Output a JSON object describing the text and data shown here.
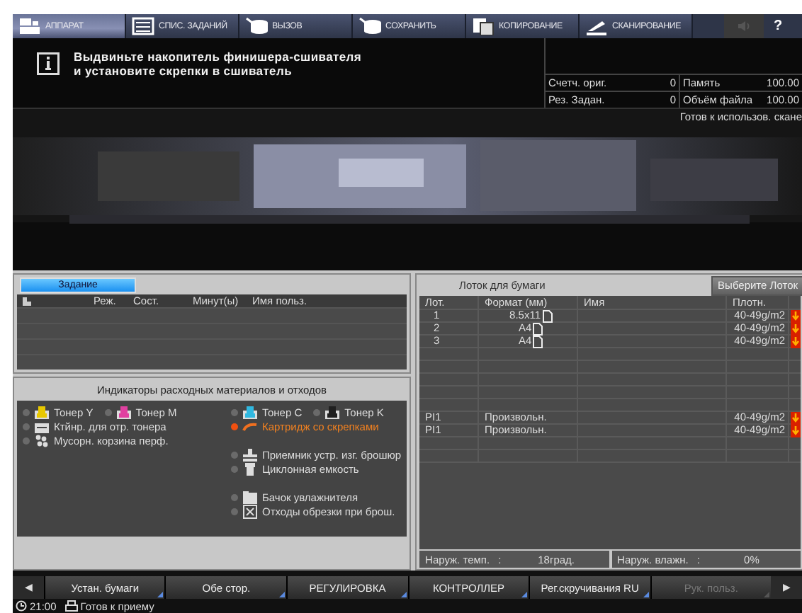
{
  "tabs": [
    {
      "label": "АППАРАТ",
      "kind": "machine",
      "selected": true
    },
    {
      "label": "СПИС. ЗАДАНИЙ",
      "kind": "list",
      "selected": false
    },
    {
      "label": "ВЫЗОВ",
      "kind": "recall",
      "selected": false
    },
    {
      "label": "СОХРАНИТЬ",
      "kind": "save",
      "selected": false
    },
    {
      "label": "КОПИРОВАНИЕ",
      "kind": "copy",
      "selected": false
    },
    {
      "label": "СКАНИРОВАНИЕ",
      "kind": "scan",
      "selected": false
    }
  ],
  "help": "?",
  "message": [
    "Выдвиньте накопитель финишера-сшивателя",
    "и установите скрепки в сшиватель"
  ],
  "counters": [
    {
      "label": "Счетч. ориг.",
      "value": "0"
    },
    {
      "label": "Память",
      "value": "100.00"
    },
    {
      "label": "Рез. Задан.",
      "value": "0"
    },
    {
      "label": "Объём файла",
      "value": "100.00"
    }
  ],
  "machine_status": "Готов к использов. скане",
  "jobs": {
    "tab": "Задание",
    "columns": [
      "Реж.",
      "Сост.",
      "Минут(ы)",
      "Имя польз."
    ]
  },
  "consumables": {
    "title": "Индикаторы расходных материалов и отходов",
    "columns": [
      {
        "groups": [
          {
            "rows": [
              {
                "items": [
                  {
                    "label": "Тонер Y",
                    "kind": "toner",
                    "color": "#e8c800",
                    "alert": false
                  },
                  {
                    "label": "Тонер M",
                    "kind": "toner",
                    "color": "#e040a0",
                    "alert": false
                  }
                ]
              },
              {
                "items": [
                  {
                    "label": "Ктйнр. для отр. тонера",
                    "kind": "waste",
                    "alert": false
                  }
                ]
              },
              {
                "items": [
                  {
                    "label": "Мусорн. корзина перф.",
                    "kind": "punch",
                    "alert": false
                  }
                ]
              }
            ]
          }
        ]
      },
      {
        "groups": [
          {
            "rows": [
              {
                "items": [
                  {
                    "label": "Тонер C",
                    "kind": "toner",
                    "color": "#30b8e0",
                    "alert": false
                  },
                  {
                    "label": "Тонер K",
                    "kind": "toner",
                    "color": "#202020",
                    "alert": false
                  }
                ]
              },
              {
                "items": [
                  {
                    "label": "Картридж со скрепками",
                    "kind": "staple",
                    "alert": true
                  }
                ]
              }
            ]
          },
          {
            "rows": [
              {
                "items": [
                  {
                    "label": "Приемник устр. изг. брошюр",
                    "kind": "tray",
                    "alert": false
                  }
                ]
              },
              {
                "items": [
                  {
                    "label": "Циклонная емкость",
                    "kind": "cyclone",
                    "alert": false
                  }
                ]
              }
            ]
          },
          {
            "rows": [
              {
                "items": [
                  {
                    "label": "Бачок увлажнителя",
                    "kind": "tank",
                    "alert": false
                  }
                ]
              },
              {
                "items": [
                  {
                    "label": "Отходы обрезки при брош.",
                    "kind": "trim",
                    "alert": false
                  }
                ]
              }
            ]
          }
        ]
      }
    ]
  },
  "trays": {
    "title": "Лоток для бумаги",
    "button": "Выберите Лоток",
    "columns": [
      "Лот.",
      "Формат (мм)",
      "Имя",
      "Плотн."
    ],
    "rows": [
      {
        "lot": "1",
        "format": "8.5x11",
        "portrait": true,
        "weight": "40-49g/m2",
        "empty": true
      },
      {
        "lot": "2",
        "format": "A4",
        "portrait": true,
        "weight": "40-49g/m2",
        "empty": true
      },
      {
        "lot": "3",
        "format": "A4",
        "portrait": true,
        "weight": "40-49g/m2",
        "empty": true
      },
      null,
      null,
      null,
      null,
      null,
      {
        "lot": "PI1",
        "format": "Произвольн.",
        "portrait": false,
        "weight": "40-49g/m2",
        "empty": true
      },
      {
        "lot": "PI1",
        "format": "Произвольн.",
        "portrait": false,
        "weight": "40-49g/m2",
        "empty": true
      },
      null,
      null
    ],
    "footer": [
      {
        "label": "Наруж. темп.",
        "sep": ":",
        "value": "18град."
      },
      {
        "label": "Наруж. влажн.",
        "sep": ":",
        "value": "0%"
      }
    ]
  },
  "bottom_buttons": [
    {
      "label": "Устан. бумаги",
      "disabled": false
    },
    {
      "label": "Обе стор.",
      "disabled": false
    },
    {
      "label": "РЕГУЛИРОВКА",
      "disabled": false
    },
    {
      "label": "КОНТРОЛЛЕР",
      "disabled": false
    },
    {
      "label": "Рег.скручивания RU",
      "disabled": false
    },
    {
      "label": "Рук. польз.",
      "disabled": true
    }
  ],
  "nav": {
    "prev": "◀",
    "next": "▶"
  },
  "status_bar": {
    "time": "21:00",
    "text": "Готов к приему"
  }
}
